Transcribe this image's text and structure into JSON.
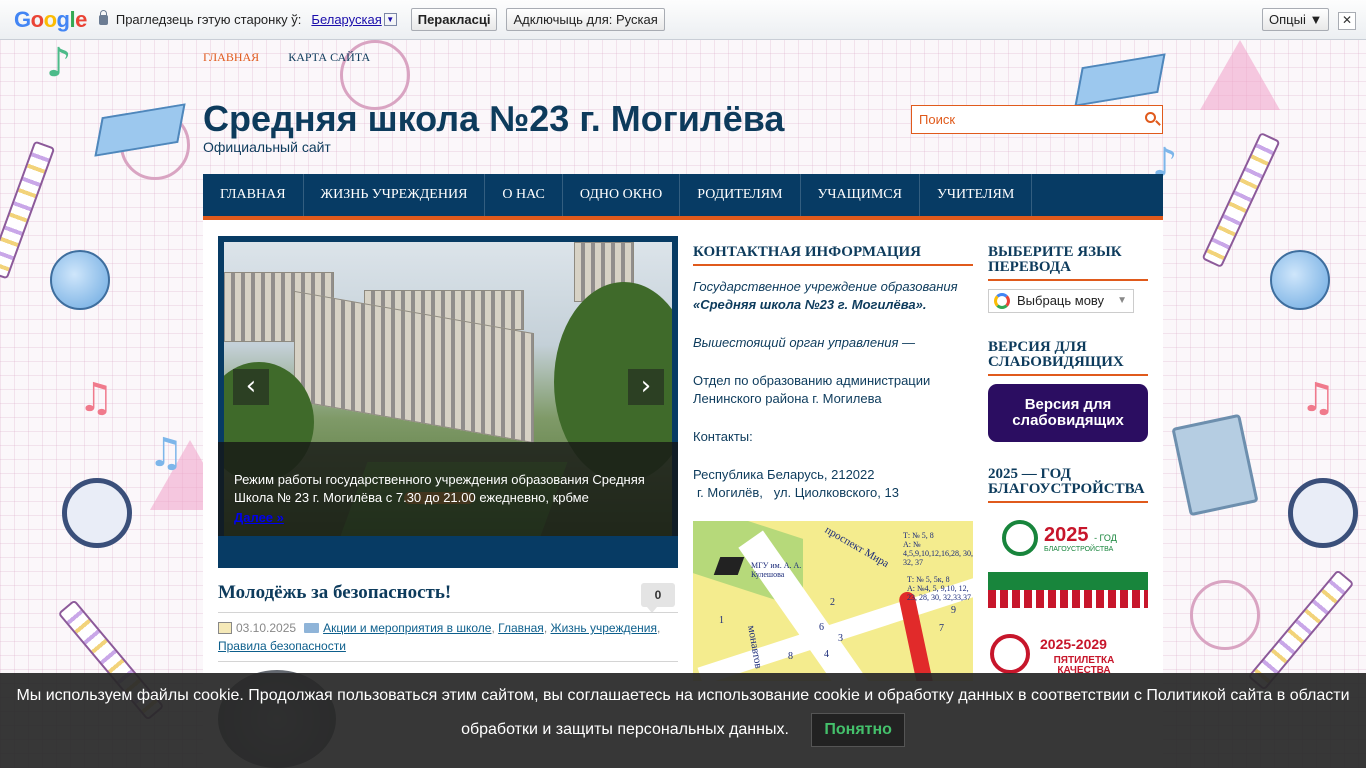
{
  "translate_bar": {
    "brand": [
      "G",
      "o",
      "o",
      "g",
      "l",
      "e"
    ],
    "prompt": "Прагледзець гэтую старонку ў:",
    "language": "Беларуская",
    "translate_button": "Перакласці",
    "disable_button": "Адключыць для: Руская",
    "options_button": "Опцыі ▼",
    "close_symbol": "✕"
  },
  "top_links": [
    "ГЛАВНАЯ",
    "КАРТА САЙТА"
  ],
  "site": {
    "title": "Средняя школа №23 г. Могилёва",
    "description": "Официальный сайт"
  },
  "search": {
    "placeholder": "Поиск"
  },
  "nav": [
    "ГЛАВНАЯ",
    "ЖИЗНЬ УЧРЕЖДЕНИЯ",
    "О НАС",
    "ОДНО ОКНО",
    "РОДИТЕЛЯМ",
    "УЧАЩИМСЯ",
    "УЧИТЕЛЯМ"
  ],
  "slider": {
    "prev_symbol": "‹",
    "next_symbol": "›",
    "caption": "Режим работы государственного учреждения образования Средняя Школа № 23 г. Могилёва с 7.30 до 21.00 ежедневно, крбме",
    "more": "Далее »"
  },
  "post": {
    "title": "Молодёжь за безопасность!",
    "comments": "0",
    "date": "03.10.2025",
    "categories": [
      "Акции и мероприятия в школе",
      "Главная",
      "Жизнь учреждения",
      "Правила безопасности"
    ]
  },
  "contact": {
    "title": "КОНТАКТНАЯ ИНФОРМАЦИЯ",
    "line1": "Государственное учреждение образования",
    "line1_bold": "«Средняя школа №23 г. Могилёва».",
    "line2": "Вышестоящий орган управления —",
    "line3": "Отдел по образованию администрации Ленинского района г. Могилева",
    "line4": "Контакты:",
    "line5": "Республика Беларусь, 212022",
    "line6": "г. Могилёв,   ул. Циолковского, 13"
  },
  "map": {
    "labels": [
      "МГУ им. А. А. Кулешова",
      "проспект Мира",
      "Т: № 5, 8",
      "А: № 4,5,9,10,12,16,28, 30, 32, 37",
      "Т: № 5, 5к, 8",
      "А: №4, 5, 9,10, 12, 23, 28, 30, 32,33,37",
      "монавтов"
    ],
    "numbers": [
      "1",
      "2",
      "3",
      "4",
      "6",
      "7",
      "8",
      "9"
    ]
  },
  "lang_widget": {
    "title": "ВЫБЕРИТЕ ЯЗЫК ПЕРЕВОДА",
    "select_label": "Выбраць мову",
    "arrow": "▼"
  },
  "low_vision": {
    "title": "ВЕРСИЯ ДЛЯ СЛАБОВИДЯЩИХ",
    "button": "Версия для слабовидящих"
  },
  "year_widget": {
    "title": "2025 — ГОД БЛАГОУСТРОЙСТВА",
    "banner1_text": "2025",
    "banner1_suffix": "- ГОД",
    "banner1_sub": "БЛАГОУСТРОЙСТВА",
    "banner2_text": "2025-2029",
    "banner2_sub": "ПЯТИЛЕТКА КАЧЕСТВА"
  },
  "cookie": {
    "text": "Мы используем файлы cookie. Продолжая пользоваться этим сайтом, вы соглашаетесь на использование cookie и обработку данных в соответствии с Политикой сайта в области обработки и защиты персональных данных.",
    "button": "Понятно"
  },
  "colors": {
    "navy": "#073b64",
    "accent_orange": "#e05a1c",
    "low_vision_button": "#2b0d61",
    "cookie_button_text": "#44c06b"
  }
}
